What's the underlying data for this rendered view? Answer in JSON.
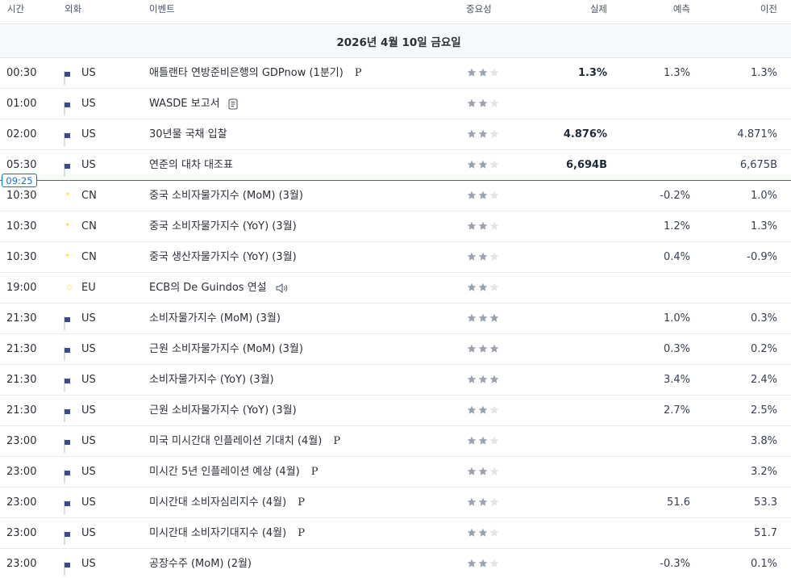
{
  "header": {
    "time": "시간",
    "currency": "외화",
    "event": "이벤트",
    "importance": "중요성",
    "actual": "실제",
    "forecast": "예측",
    "previous": "이전"
  },
  "date_label": "2026년 4월 10일 금요일",
  "now_label": "09:25",
  "colors": {
    "accent": "#1e6fd0",
    "star_on": "#9aa3ad",
    "star_off": "#e1e4e8"
  },
  "events": [
    {
      "time": "00:30",
      "flag": "us",
      "currency": "US",
      "event": "애틀랜타 연방준비은행의 GDPnow (1분기)",
      "tag": "P",
      "icon": "",
      "stars": 2,
      "actual": "1.3%",
      "forecast": "1.3%",
      "previous": "1.3%"
    },
    {
      "time": "01:00",
      "flag": "us",
      "currency": "US",
      "event": "WASDE 보고서",
      "tag": "",
      "icon": "document-icon",
      "stars": 2,
      "actual": "",
      "forecast": "",
      "previous": ""
    },
    {
      "time": "02:00",
      "flag": "us",
      "currency": "US",
      "event": "30년물 국채 입찰",
      "tag": "",
      "icon": "",
      "stars": 2,
      "actual": "4.876%",
      "forecast": "",
      "previous": "4.871%"
    },
    {
      "time": "05:30",
      "flag": "us",
      "currency": "US",
      "event": "연준의 대차 대조표",
      "tag": "",
      "icon": "",
      "stars": 2,
      "actual": "6,694B",
      "forecast": "",
      "previous": "6,675B"
    },
    {
      "time": "10:30",
      "flag": "cn",
      "currency": "CN",
      "event": "중국 소비자물가지수 (MoM) (3월)",
      "tag": "",
      "icon": "",
      "stars": 2,
      "actual": "",
      "forecast": "-0.2%",
      "previous": "1.0%"
    },
    {
      "time": "10:30",
      "flag": "cn",
      "currency": "CN",
      "event": "중국 소비자물가지수 (YoY) (3월)",
      "tag": "",
      "icon": "",
      "stars": 2,
      "actual": "",
      "forecast": "1.2%",
      "previous": "1.3%"
    },
    {
      "time": "10:30",
      "flag": "cn",
      "currency": "CN",
      "event": "중국 생산자물가지수 (YoY) (3월)",
      "tag": "",
      "icon": "",
      "stars": 2,
      "actual": "",
      "forecast": "0.4%",
      "previous": "-0.9%"
    },
    {
      "time": "19:00",
      "flag": "eu",
      "currency": "EU",
      "event": "ECB의 De Guindos 연설",
      "tag": "",
      "icon": "speaker-icon",
      "stars": 2,
      "actual": "",
      "forecast": "",
      "previous": ""
    },
    {
      "time": "21:30",
      "flag": "us",
      "currency": "US",
      "event": "소비자물가지수 (MoM) (3월)",
      "tag": "",
      "icon": "",
      "stars": 3,
      "actual": "",
      "forecast": "1.0%",
      "previous": "0.3%"
    },
    {
      "time": "21:30",
      "flag": "us",
      "currency": "US",
      "event": "근원 소비자물가지수 (MoM) (3월)",
      "tag": "",
      "icon": "",
      "stars": 3,
      "actual": "",
      "forecast": "0.3%",
      "previous": "0.2%"
    },
    {
      "time": "21:30",
      "flag": "us",
      "currency": "US",
      "event": "소비자물가지수 (YoY) (3월)",
      "tag": "",
      "icon": "",
      "stars": 3,
      "actual": "",
      "forecast": "3.4%",
      "previous": "2.4%"
    },
    {
      "time": "21:30",
      "flag": "us",
      "currency": "US",
      "event": "근원 소비자물가지수 (YoY) (3월)",
      "tag": "",
      "icon": "",
      "stars": 2,
      "actual": "",
      "forecast": "2.7%",
      "previous": "2.5%"
    },
    {
      "time": "23:00",
      "flag": "us",
      "currency": "US",
      "event": "미국 미시간대 인플레이션 기대치 (4월)",
      "tag": "P",
      "icon": "",
      "stars": 2,
      "actual": "",
      "forecast": "",
      "previous": "3.8%"
    },
    {
      "time": "23:00",
      "flag": "us",
      "currency": "US",
      "event": "미시간 5년 인플레이션 예상 (4월)",
      "tag": "P",
      "icon": "",
      "stars": 2,
      "actual": "",
      "forecast": "",
      "previous": "3.2%"
    },
    {
      "time": "23:00",
      "flag": "us",
      "currency": "US",
      "event": "미시간대 소비자심리지수 (4월)",
      "tag": "P",
      "icon": "",
      "stars": 2,
      "actual": "",
      "forecast": "51.6",
      "previous": "53.3"
    },
    {
      "time": "23:00",
      "flag": "us",
      "currency": "US",
      "event": "미시간대 소비자기대지수 (4월)",
      "tag": "P",
      "icon": "",
      "stars": 2,
      "actual": "",
      "forecast": "",
      "previous": "51.7"
    },
    {
      "time": "23:00",
      "flag": "us",
      "currency": "US",
      "event": "공장수주 (MoM) (2월)",
      "tag": "",
      "icon": "",
      "stars": 2,
      "actual": "",
      "forecast": "-0.3%",
      "previous": "0.1%"
    }
  ]
}
